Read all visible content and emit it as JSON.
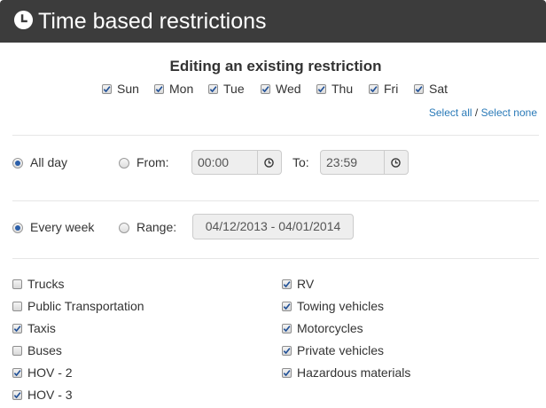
{
  "window": {
    "title": "Time based restrictions",
    "icon": "clock-icon"
  },
  "heading": "Editing an existing restriction",
  "days": [
    {
      "label": "Sun",
      "checked": true
    },
    {
      "label": "Mon",
      "checked": true
    },
    {
      "label": "Tue",
      "checked": true
    },
    {
      "label": "Wed",
      "checked": true
    },
    {
      "label": "Thu",
      "checked": true
    },
    {
      "label": "Fri",
      "checked": true
    },
    {
      "label": "Sat",
      "checked": true
    }
  ],
  "select_links": {
    "all": "Select all",
    "separator": "/",
    "none": "Select none"
  },
  "time": {
    "all_day_label": "All day",
    "all_day_selected": true,
    "from_label": "From:",
    "from_value": "00:00",
    "to_label": "To:",
    "to_value": "23:59"
  },
  "period": {
    "every_week_label": "Every week",
    "every_week_selected": true,
    "range_label": "Range:",
    "range_value": "04/12/2013 - 04/01/2014"
  },
  "vehicles_left": [
    {
      "label": "Trucks",
      "checked": false
    },
    {
      "label": "Public Transportation",
      "checked": false
    },
    {
      "label": "Taxis",
      "checked": true
    },
    {
      "label": "Buses",
      "checked": false
    },
    {
      "label": "HOV - 2",
      "checked": true
    },
    {
      "label": "HOV - 3",
      "checked": true
    }
  ],
  "vehicles_right": [
    {
      "label": "RV",
      "checked": true
    },
    {
      "label": "Towing vehicles",
      "checked": true
    },
    {
      "label": "Motorcycles",
      "checked": true
    },
    {
      "label": "Private vehicles",
      "checked": true
    },
    {
      "label": "Hazardous materials",
      "checked": true
    }
  ],
  "colors": {
    "title_bar": "#3c3c3c",
    "link": "#2a7ab8",
    "radio_dot": "#2b5fa9"
  }
}
